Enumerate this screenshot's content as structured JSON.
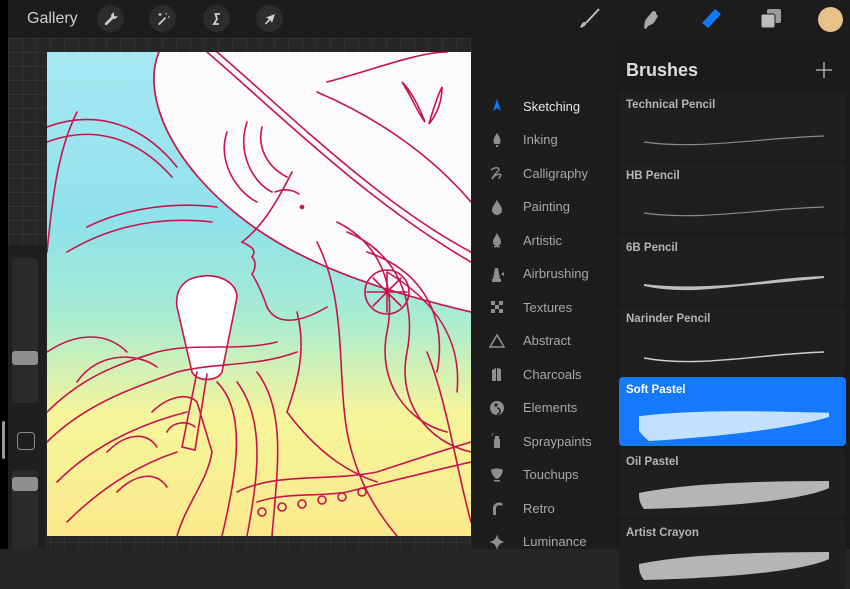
{
  "topbar": {
    "gallery_label": "Gallery",
    "left_tools": [
      {
        "name": "actions",
        "icon": "wrench-icon"
      },
      {
        "name": "adjustments",
        "icon": "magic-wand-icon"
      },
      {
        "name": "selection",
        "icon": "selection-s-icon"
      },
      {
        "name": "transform",
        "icon": "arrow-cursor-icon"
      }
    ],
    "right_tools": [
      {
        "name": "brush",
        "icon": "brush-icon",
        "active": false
      },
      {
        "name": "smudge",
        "icon": "smudge-finger-icon",
        "active": false
      },
      {
        "name": "eraser",
        "icon": "eraser-icon",
        "active": true
      },
      {
        "name": "layers",
        "icon": "layers-icon",
        "active": false
      }
    ],
    "current_color": "#e8c08a"
  },
  "colors": {
    "accent": "#1479fa",
    "panel_bg": "#1b1b1b",
    "line_art": "#c8134d"
  },
  "brush_library": {
    "title": "Brushes",
    "add_icon": "plus-icon",
    "categories": [
      {
        "label": "Sketching",
        "icon": "pencil-tip-icon",
        "active": true
      },
      {
        "label": "Inking",
        "icon": "pen-nib-icon",
        "active": false
      },
      {
        "label": "Calligraphy",
        "icon": "calligraphy-scribble-icon",
        "active": false
      },
      {
        "label": "Painting",
        "icon": "paint-drop-icon",
        "active": false
      },
      {
        "label": "Artistic",
        "icon": "flame-drop-icon",
        "active": false
      },
      {
        "label": "Airbrushing",
        "icon": "airbrush-icon",
        "active": false
      },
      {
        "label": "Textures",
        "icon": "checker-texture-icon",
        "active": false
      },
      {
        "label": "Abstract",
        "icon": "triangle-icon",
        "active": false
      },
      {
        "label": "Charcoals",
        "icon": "charcoal-stick-icon",
        "active": false
      },
      {
        "label": "Elements",
        "icon": "yin-yang-icon",
        "active": false
      },
      {
        "label": "Spraypaints",
        "icon": "spray-can-icon",
        "active": false
      },
      {
        "label": "Touchups",
        "icon": "makeup-brush-icon",
        "active": false
      },
      {
        "label": "Retro",
        "icon": "retro-arch-icon",
        "active": false
      },
      {
        "label": "Luminance",
        "icon": "sparkle-star-icon",
        "active": false
      }
    ],
    "brushes": [
      {
        "name": "Technical Pencil",
        "stroke": "thin",
        "selected": false
      },
      {
        "name": "HB Pencil",
        "stroke": "thin",
        "selected": false
      },
      {
        "name": "6B Pencil",
        "stroke": "grainy-medium",
        "selected": false
      },
      {
        "name": "Narinder Pencil",
        "stroke": "thin-bright",
        "selected": false
      },
      {
        "name": "Soft Pastel",
        "stroke": "soft-wide",
        "selected": true
      },
      {
        "name": "Oil Pastel",
        "stroke": "textured-wide",
        "selected": false
      },
      {
        "name": "Artist Crayon",
        "stroke": "textured-wide",
        "selected": false
      }
    ]
  },
  "sidebar": {
    "brush_size_level": 0.67,
    "opacity_level": 0.1,
    "modify_button_icon": "square-outline-icon"
  }
}
